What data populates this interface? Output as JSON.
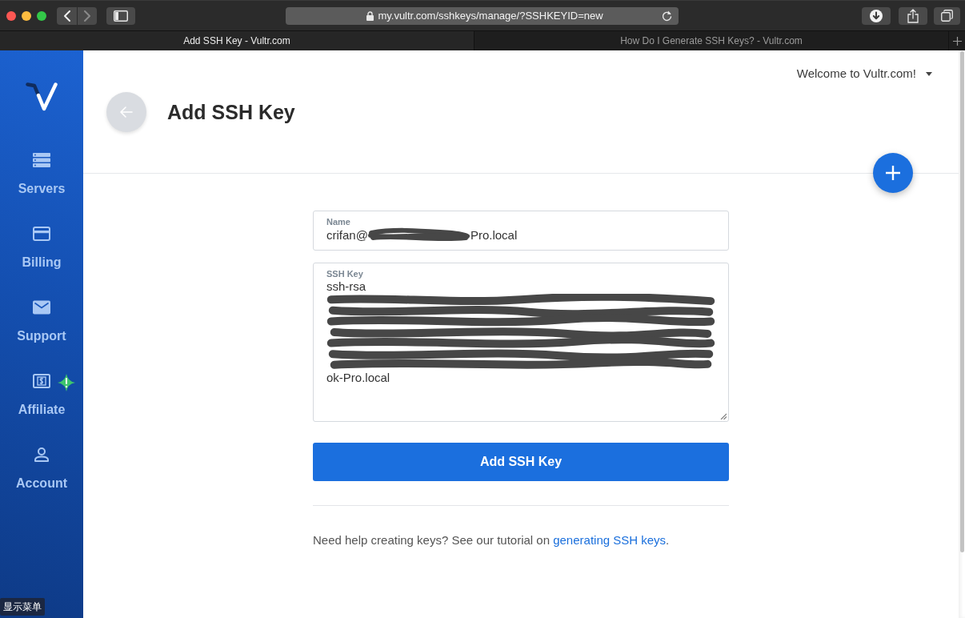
{
  "browser": {
    "forward_disabled": true,
    "url": "my.vultr.com/sshkeys/manage/?SSHKEYID=new",
    "tabs": [
      {
        "title": "Add SSH Key - Vultr.com",
        "selected": true
      },
      {
        "title": "How Do I Generate SSH Keys? - Vultr.com",
        "selected": false
      }
    ]
  },
  "sidebar": {
    "items": [
      {
        "kind": "servers",
        "label": "Servers",
        "alert": false
      },
      {
        "kind": "billing",
        "label": "Billing",
        "alert": false
      },
      {
        "kind": "support",
        "label": "Support",
        "alert": false
      },
      {
        "kind": "affiliate",
        "label": "Affiliate",
        "alert": true
      },
      {
        "kind": "account",
        "label": "Account",
        "alert": false
      }
    ]
  },
  "header": {
    "welcome_menu": "Welcome to Vultr.com!",
    "title": "Add SSH Key"
  },
  "form": {
    "fields": [
      {
        "kind": "input",
        "label": "Name",
        "value": [
          {
            "kind": "text",
            "text": "crifan@"
          },
          {
            "kind": "redacted"
          },
          {
            "kind": "text",
            "text": "Pro.local"
          }
        ]
      },
      {
        "kind": "textarea",
        "label": "SSH Key",
        "value": [
          {
            "kind": "text",
            "text": "ssh-rsa"
          },
          {
            "kind": "redacted"
          },
          {
            "kind": "text",
            "text": "ok-Pro.local"
          }
        ]
      }
    ],
    "submit": "Add SSH Key"
  },
  "help": {
    "text": "Need help creating keys? See our tutorial on",
    "link": "generating SSH keys",
    "after": "."
  },
  "tooltip": "显示菜单"
}
